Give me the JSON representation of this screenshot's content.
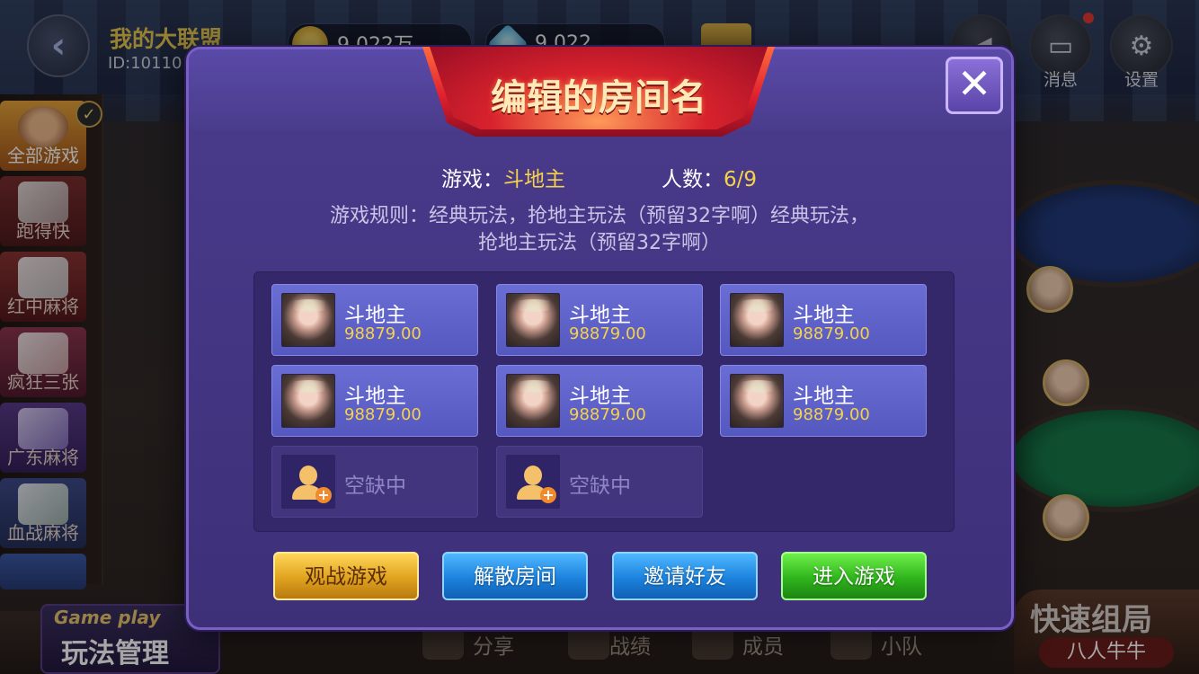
{
  "background": {
    "alliance_name": "我的大联盟",
    "alliance_id": "ID:10110",
    "currency": [
      {
        "icon": "gold-coin-icon",
        "value": "9,022万"
      },
      {
        "icon": "diamond-icon",
        "value": "9,022"
      }
    ],
    "top_icons": [
      {
        "icon": "message-icon",
        "label": "消息"
      },
      {
        "icon": "gear-icon",
        "label": "设置"
      }
    ],
    "categories": [
      {
        "label": "全部游戏",
        "active": true
      },
      {
        "label": "跑得快"
      },
      {
        "label": "红中麻将"
      },
      {
        "label": "疯狂三张"
      },
      {
        "label": "广东麻将"
      },
      {
        "label": "血战麻将"
      }
    ],
    "play_manage": {
      "en": "Game play",
      "cn": "玩法管理"
    },
    "bottom_nav": [
      {
        "icon": "chat-icon",
        "label": "分享"
      },
      {
        "icon": "medal-icon",
        "label": "战绩"
      },
      {
        "icon": "members-icon",
        "label": "成员"
      },
      {
        "icon": "flag-icon",
        "label": "小队"
      }
    ],
    "quick_group": {
      "title": "快速组局",
      "sub": "八人牛牛"
    }
  },
  "modal": {
    "title": "编辑的房间名",
    "game_label": "游戏：",
    "game_value": "斗地主",
    "players_label": "人数：",
    "players_value": "6/9",
    "rules_line1": "游戏规则：经典玩法，抢地主玩法（预留32字啊）经典玩法，",
    "rules_line2": "抢地主玩法（预留32字啊）",
    "seats": [
      {
        "name": "斗地主",
        "score": "98879.00"
      },
      {
        "name": "斗地主",
        "score": "98879.00"
      },
      {
        "name": "斗地主",
        "score": "98879.00"
      },
      {
        "name": "斗地主",
        "score": "98879.00"
      },
      {
        "name": "斗地主",
        "score": "98879.00"
      },
      {
        "name": "斗地主",
        "score": "98879.00"
      }
    ],
    "empty_seats": [
      {
        "label": "空缺中"
      },
      {
        "label": "空缺中"
      }
    ],
    "buttons": {
      "spectate": "观战游戏",
      "dissolve": "解散房间",
      "invite": "邀请好友",
      "enter": "进入游戏"
    },
    "colors": {
      "accent_gold": "#f5d24a",
      "panel": "#3d2f78",
      "title_red": "#e0202e"
    }
  }
}
